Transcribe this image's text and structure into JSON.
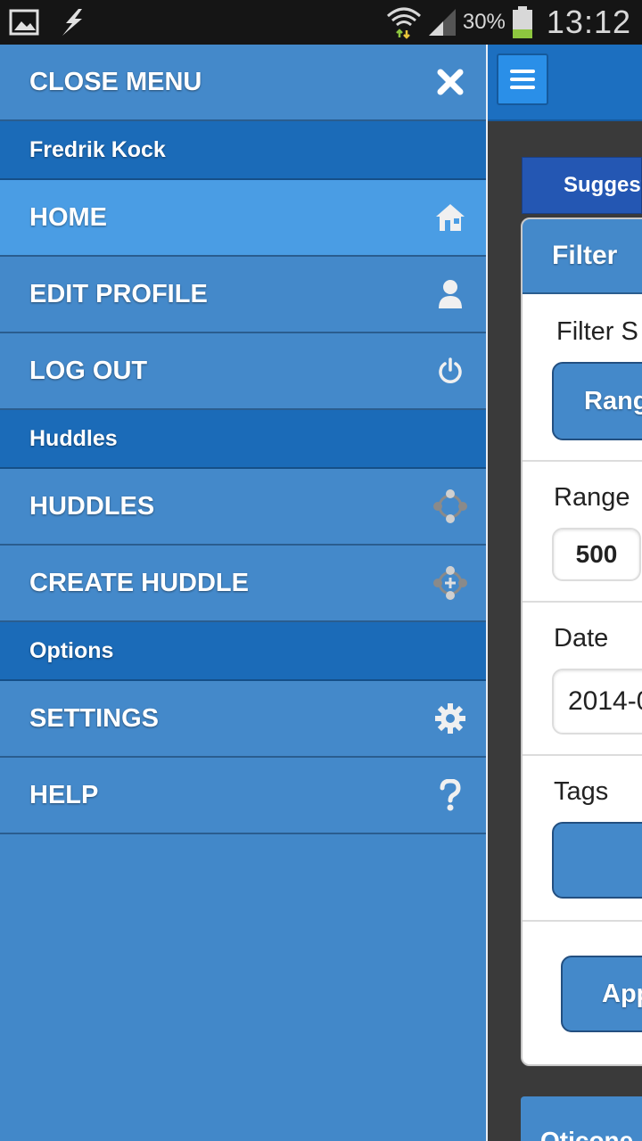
{
  "status_bar": {
    "battery_percent": "30%",
    "time": "13:12"
  },
  "drawer": {
    "close_label": "CLOSE MENU",
    "user_name": "Fredrik Kock",
    "items": [
      {
        "label": "HOME",
        "icon": "home-icon"
      },
      {
        "label": "EDIT PROFILE",
        "icon": "user-icon"
      },
      {
        "label": "LOG OUT",
        "icon": "power-icon"
      }
    ],
    "huddles_header": "Huddles",
    "huddle_items": [
      {
        "label": "HUDDLES",
        "icon": "huddles-icon"
      },
      {
        "label": "CREATE HUDDLE",
        "icon": "create-huddle-icon"
      }
    ],
    "options_header": "Options",
    "option_items": [
      {
        "label": "SETTINGS",
        "icon": "gear-icon"
      },
      {
        "label": "HELP",
        "icon": "help-icon"
      }
    ]
  },
  "page": {
    "suggest_tab": "Suggest",
    "filter_title": "Filter",
    "filter_sort_label": "Filter S",
    "range_button": "Rang",
    "range_label": "Range",
    "range_value": "500",
    "date_label": "Date",
    "date_value": "2014-0",
    "tags_label": "Tags",
    "apply_button": "App",
    "bottom_title": "Oticone"
  }
}
